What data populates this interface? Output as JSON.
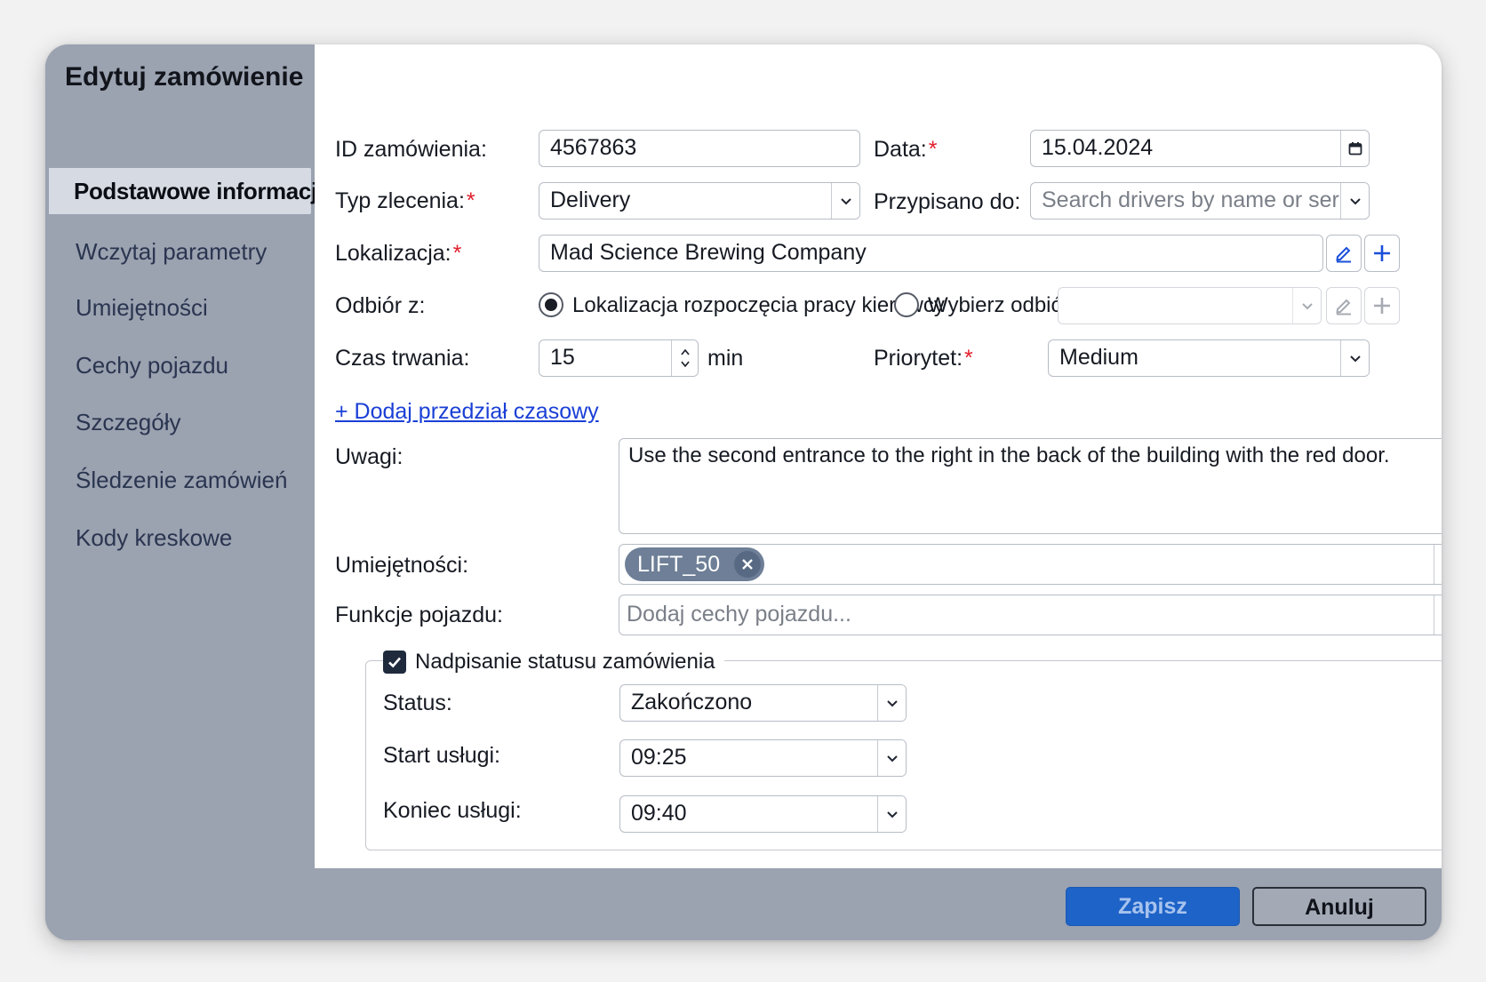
{
  "dialog": {
    "title": "Edytuj zamówienie"
  },
  "nav": {
    "items": [
      {
        "label": "Podstawowe informacje",
        "active": true
      },
      {
        "label": "Wczytaj parametry"
      },
      {
        "label": "Umiejętności"
      },
      {
        "label": "Cechy pojazdu"
      },
      {
        "label": "Szczegóły"
      },
      {
        "label": "Śledzenie zamówień"
      },
      {
        "label": "Kody kreskowe"
      }
    ]
  },
  "form": {
    "order_id": {
      "label": "ID zamówienia:",
      "value": "4567863"
    },
    "date": {
      "label": "Data:",
      "required_mark": "*",
      "value": "15.04.2024",
      "icon": "calendar-icon"
    },
    "order_type": {
      "label": "Typ zlecenia:",
      "required_mark": "*",
      "value": "Delivery"
    },
    "assigned_to": {
      "label": "Przypisano do:",
      "placeholder": "Search drivers by name or ser"
    },
    "location": {
      "label": "Lokalizacja:",
      "required_mark": "*",
      "value": "Mad Science Brewing Company"
    },
    "pickup": {
      "label": "Odbiór z:",
      "option_driver_start": "Lokalizacja rozpoczęcia pracy kierowcy",
      "option_select": "Wybierz odbiór:",
      "selected": "option_driver_start",
      "select_value": ""
    },
    "duration": {
      "label": "Czas trwania:",
      "value": "15",
      "unit": "min"
    },
    "priority": {
      "label": "Priorytet:",
      "required_mark": "*",
      "value": "Medium"
    },
    "add_time_window_link": "+ Dodaj przedział czasowy",
    "notes": {
      "label": "Uwagi:",
      "value": "Use the second entrance to the right in the back of the building with the red door."
    },
    "skills": {
      "label": "Umiejętności:",
      "chips": [
        "LIFT_50"
      ]
    },
    "vehicle_features": {
      "label": "Funkcje pojazdu:",
      "placeholder": "Dodaj cechy pojazdu..."
    },
    "status_override": {
      "checked": true,
      "label": "Nadpisanie statusu zamówienia",
      "status": {
        "label": "Status:",
        "value": "Zakończono"
      },
      "service_start": {
        "label": "Start usługi:",
        "value": "09:25"
      },
      "service_end": {
        "label": "Koniec usługi:",
        "value": "09:40"
      }
    }
  },
  "footer": {
    "save_label": "Zapisz",
    "cancel_label": "Anuluj"
  },
  "colors": {
    "required": "#e01e2b",
    "link": "#1a3fd6",
    "primary_button": "#1e63c7",
    "sidebar": "#9ba2b0",
    "chip": "#6e7f97"
  }
}
